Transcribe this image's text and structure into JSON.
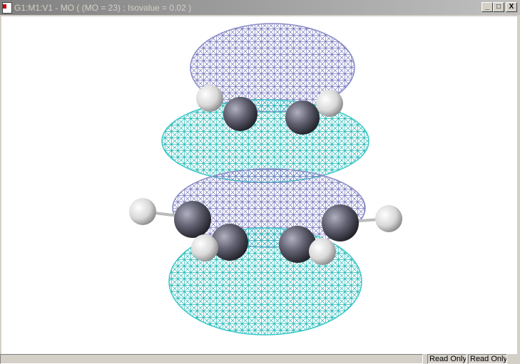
{
  "window": {
    "title": "G1:M1:V1 - MO ( (MO = 23) ; Isovalue = 0.02 )",
    "minimize": "_",
    "maximize": "□",
    "close": "X"
  },
  "viewer": {
    "mo_number": 23,
    "isovalue": 0.02,
    "colors": {
      "positive": "#8c8cc8",
      "negative": "#3cc8c8"
    }
  },
  "statusbar": {
    "cells": [
      "Read Only",
      "Read Only"
    ]
  }
}
